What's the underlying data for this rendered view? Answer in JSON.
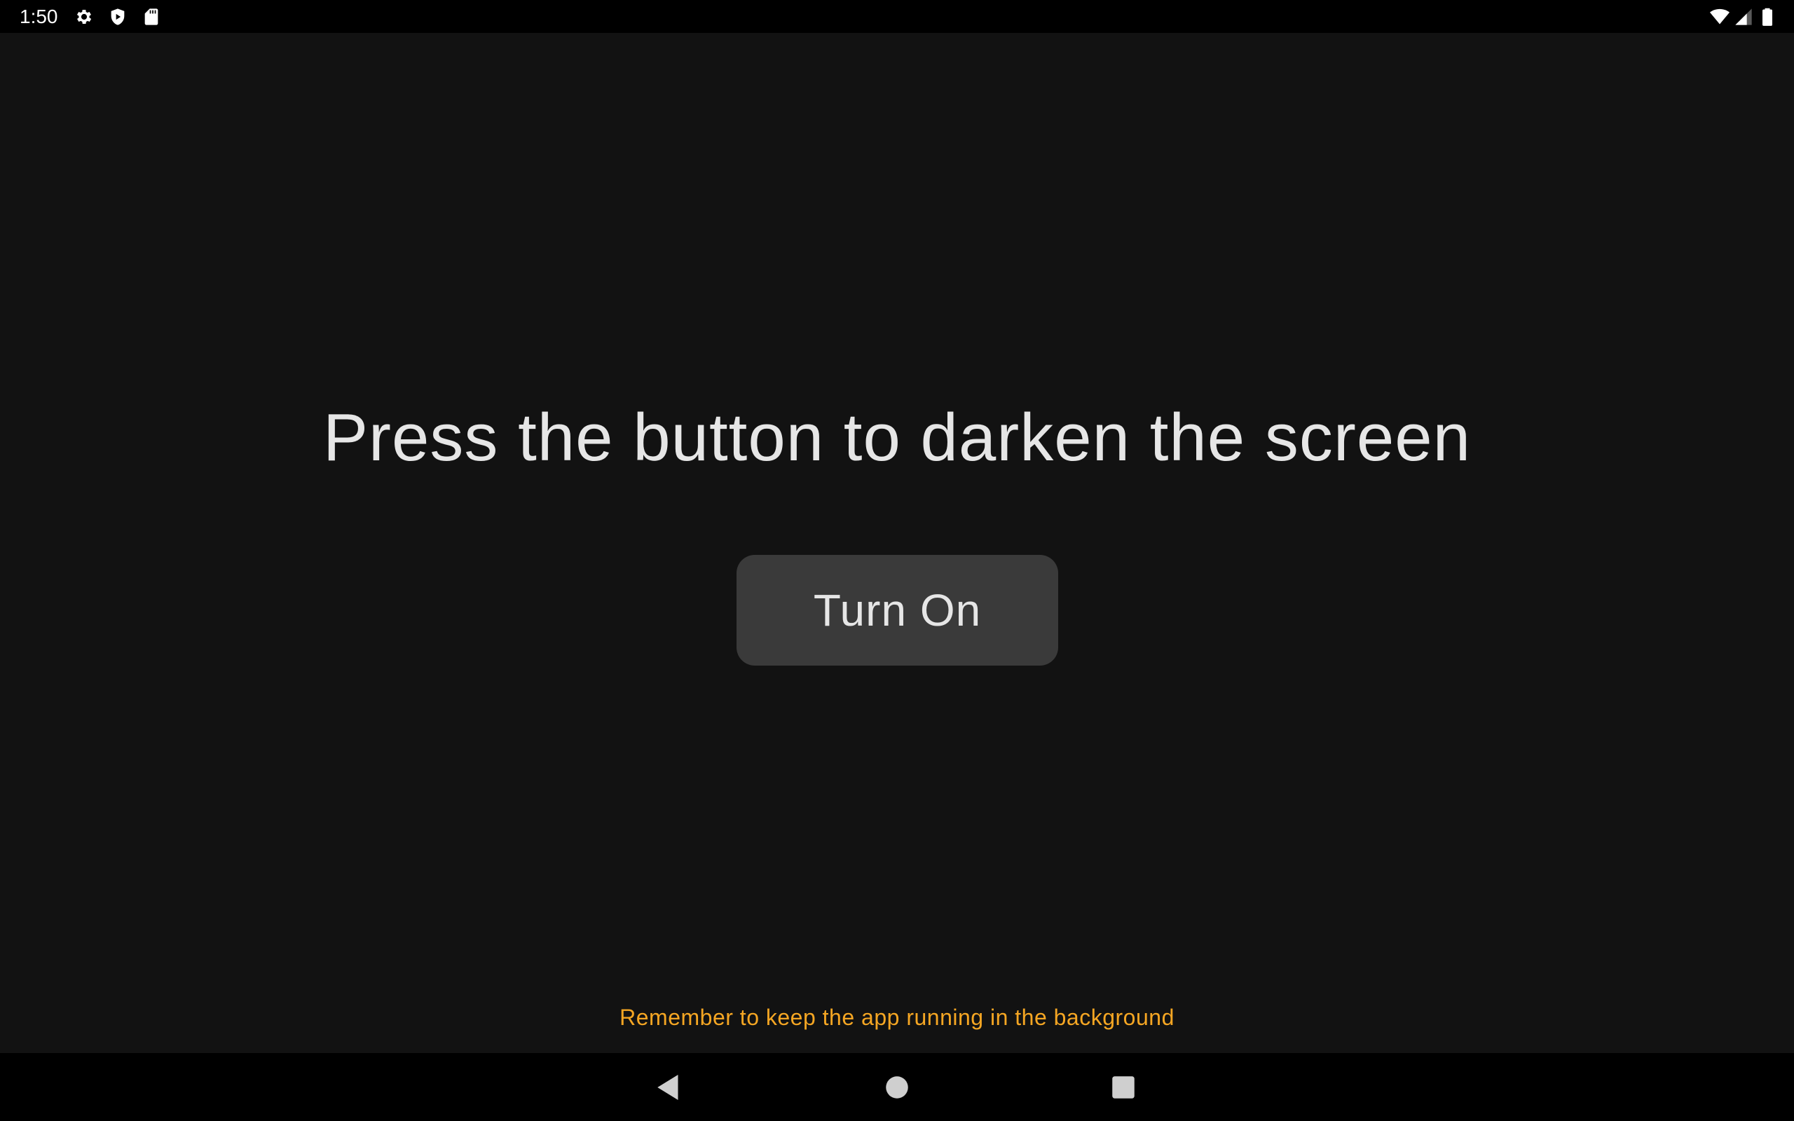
{
  "status_bar": {
    "time": "1:50",
    "left_icons": [
      "gear-icon",
      "shield-play-icon",
      "sd-card-icon"
    ],
    "right_icons": [
      "wifi-icon",
      "cell-signal-icon",
      "battery-icon"
    ]
  },
  "main": {
    "headline": "Press the button to darken the screen",
    "button_label": "Turn On",
    "reminder": "Remember to keep the app running in the background"
  },
  "nav_bar": {
    "buttons": [
      "back-icon",
      "home-icon",
      "recents-icon"
    ]
  },
  "colors": {
    "background": "#121212",
    "bars": "#000000",
    "button": "#3a3a3a",
    "text": "#e6e6e6",
    "accent": "#f5a623"
  }
}
